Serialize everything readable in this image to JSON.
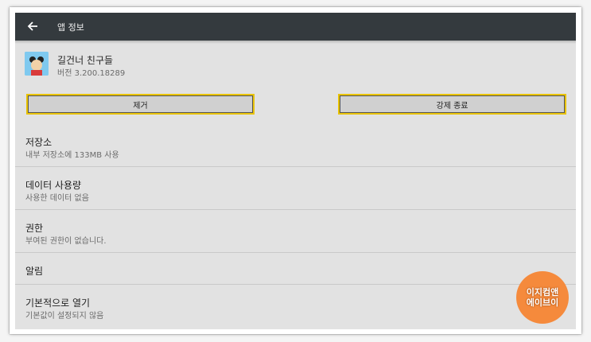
{
  "appbar": {
    "title": "앱 정보",
    "back_icon": "arrow-left-icon"
  },
  "app": {
    "name": "길건너 친구들",
    "version": "버전 3.200.18289",
    "icon": "app-icon"
  },
  "buttons": {
    "uninstall": "제거",
    "force_stop": "강제 종료"
  },
  "items": [
    {
      "title": "저장소",
      "subtitle": "내부 저장소에 133MB 사용"
    },
    {
      "title": "데이터 사용량",
      "subtitle": "사용한 데이터 없음"
    },
    {
      "title": "권한",
      "subtitle": "부여된 권한이 없습니다."
    },
    {
      "title": "알림"
    },
    {
      "title": "기본적으로 열기",
      "subtitle": "기본값이 설정되지 않음"
    }
  ],
  "watermark": {
    "line1": "이지컴앤",
    "line2": "에이브이"
  },
  "colors": {
    "appbar": "#343a3e",
    "background": "#e2e2e2",
    "highlight": "#e8c200",
    "badge": "#f58a3c"
  }
}
